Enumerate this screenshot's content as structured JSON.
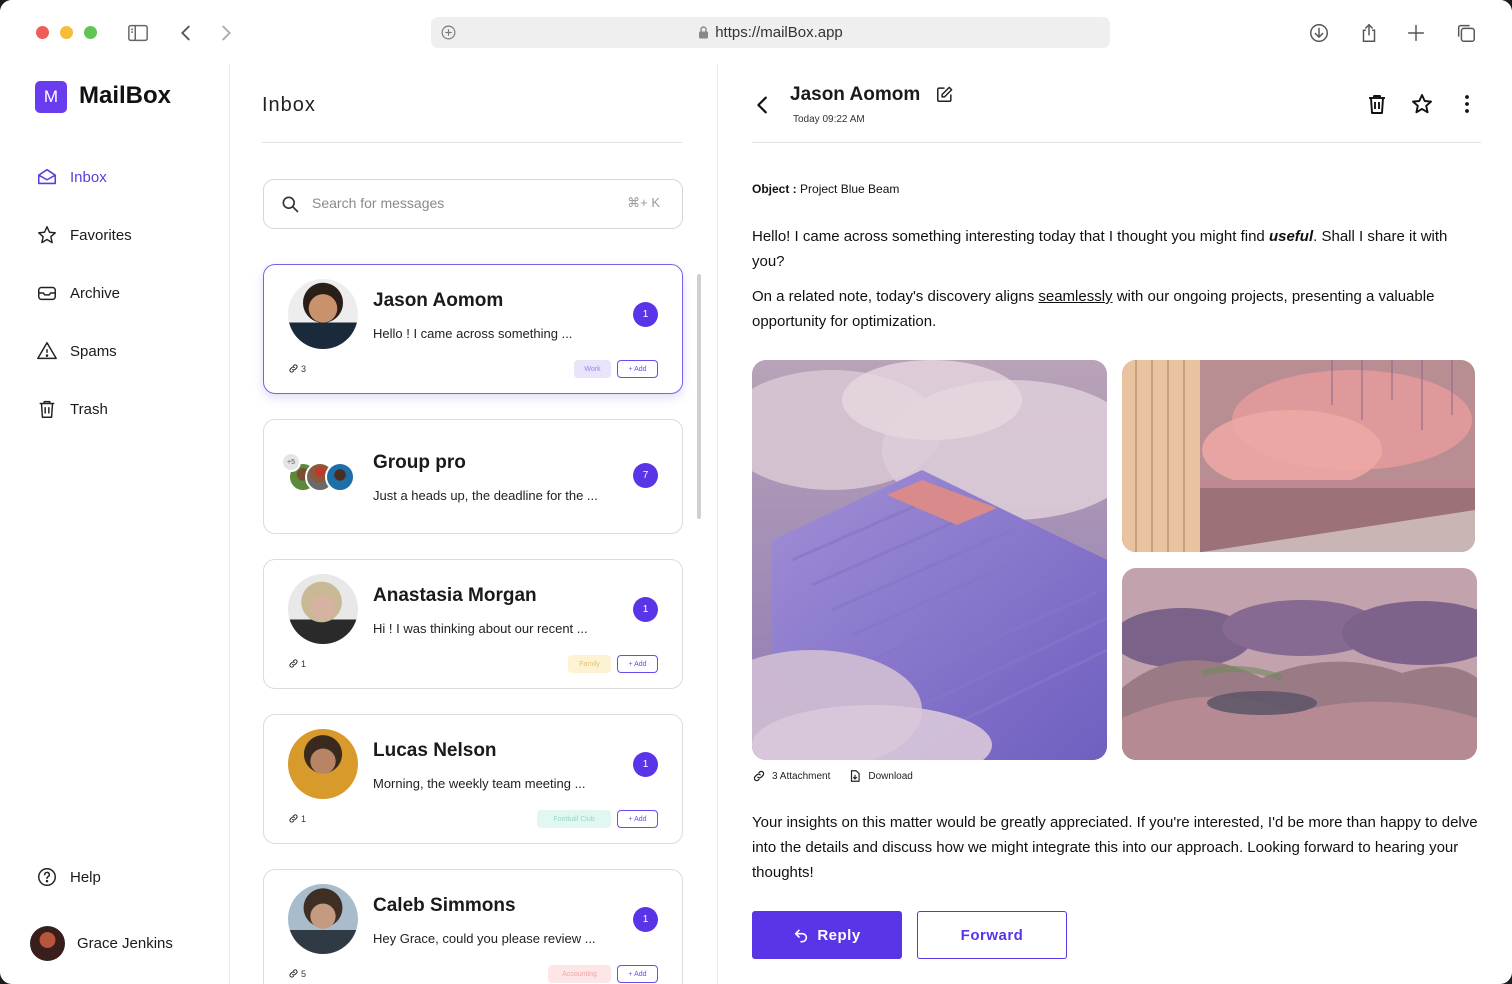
{
  "browser": {
    "url": "https://mailBox.app"
  },
  "app": {
    "logo_letter": "M",
    "name": "MailBox"
  },
  "sidebar": {
    "items": [
      {
        "label": "Inbox",
        "icon": "mail-open-icon",
        "active": true
      },
      {
        "label": "Favorites",
        "icon": "star-icon"
      },
      {
        "label": "Archive",
        "icon": "archive-icon"
      },
      {
        "label": "Spams",
        "icon": "warning-icon"
      },
      {
        "label": "Trash",
        "icon": "trash-icon"
      }
    ],
    "help_label": "Help",
    "user_name": "Grace Jenkins"
  },
  "inbox": {
    "title": "Inbox",
    "search_placeholder": "Search for messages",
    "search_shortcut": "⌘+ K",
    "add_label": "+ Add",
    "messages": [
      {
        "name": "Jason Aomom",
        "preview": "Hello ! I came across something ...",
        "unread": "1",
        "attachments": "3",
        "tag": "Work",
        "tag_color": "#e9e3fb",
        "tag_text_color": "#9b86e8"
      },
      {
        "name": "Group pro",
        "preview": "Just a heads up, the deadline for the ...",
        "unread": "7",
        "extra_members": "+5"
      },
      {
        "name": "Anastasia Morgan",
        "preview": "Hi ! I was thinking about our recent ...",
        "unread": "1",
        "attachments": "1",
        "tag": "Family",
        "tag_color": "#fdf3d4",
        "tag_text_color": "#e3c36a"
      },
      {
        "name": "Lucas Nelson",
        "preview": "Morning, the weekly team meeting ...",
        "unread": "1",
        "attachments": "1",
        "tag": "Football Club",
        "tag_color": "#e3f7f2",
        "tag_text_color": "#8fd9c6"
      },
      {
        "name": "Caleb Simmons",
        "preview": "Hey Grace, could you please review ...",
        "unread": "1",
        "attachments": "5",
        "tag": "Accounting",
        "tag_color": "#fde6e6",
        "tag_text_color": "#f0a3a3"
      }
    ]
  },
  "reader": {
    "sender": "Jason Aomom",
    "date": "Today 09:22 AM",
    "object_label": "Object :",
    "object_value": "Project Blue Beam",
    "p1_a": "Hello! I came across something interesting today that I thought you might find ",
    "p1_em": "useful",
    "p1_b": ". Shall I share it with you?",
    "p2_a": "On a related note, today's discovery aligns ",
    "p2_u": "seamlessly",
    "p2_b": " with our ongoing projects, presenting a valuable opportunity for optimization.",
    "attachment_count": "3 Attachment",
    "download_label": "Download",
    "p3": "Your insights on this matter would be greatly appreciated. If you're interested, I'd be more than happy to delve into the details and discuss how we might integrate this into our approach. Looking forward to hearing your thoughts!",
    "reply_label": "Reply",
    "forward_label": "Forward"
  },
  "colors": {
    "accent": "#5a35e8",
    "logo": "#6a3cf0"
  }
}
